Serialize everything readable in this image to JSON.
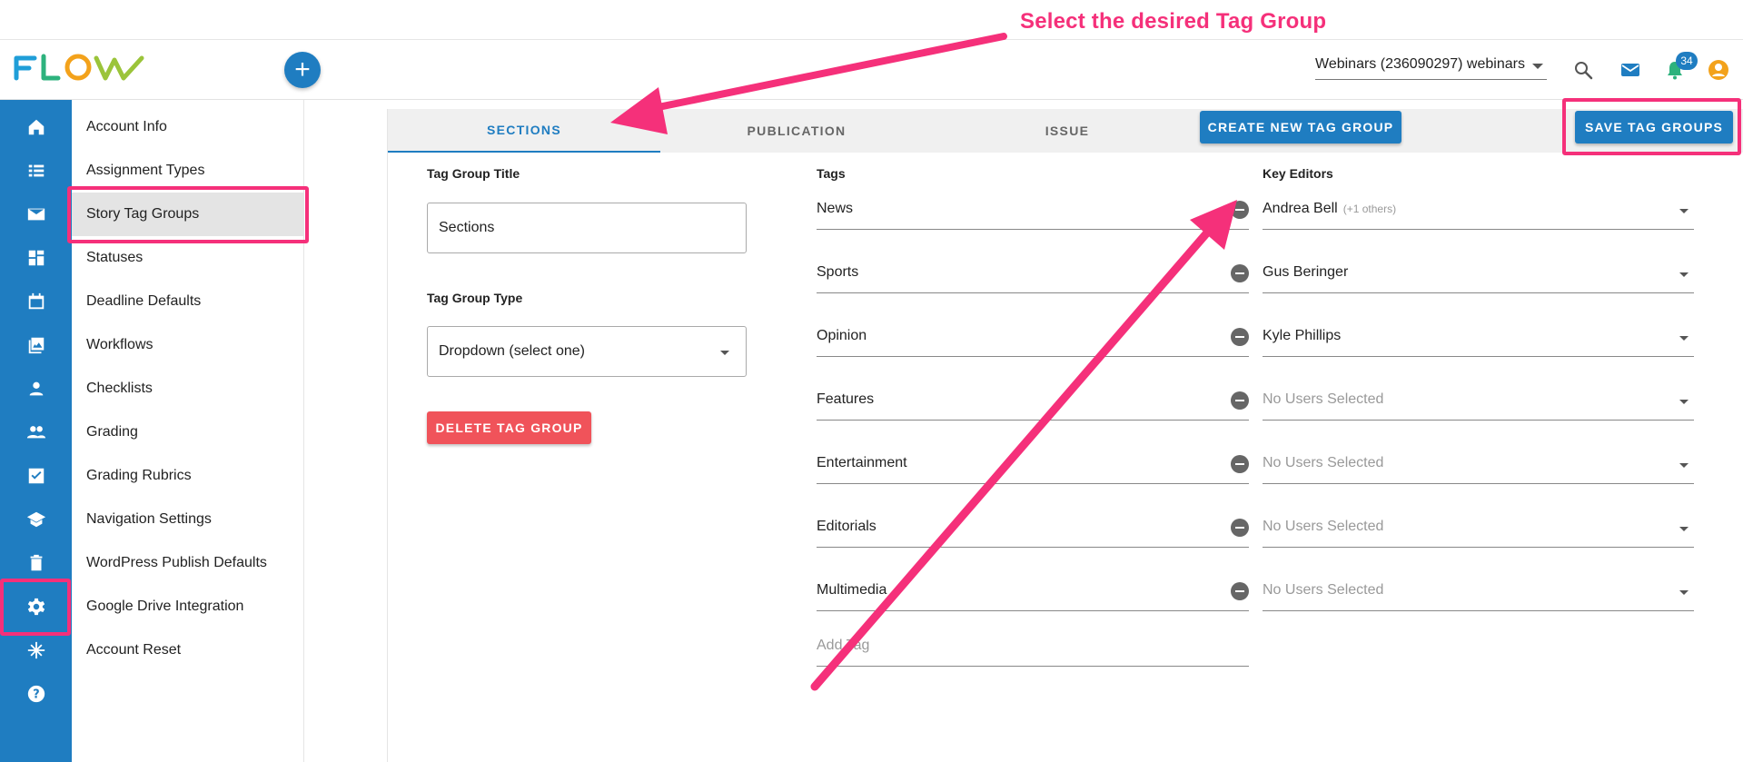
{
  "annotation": {
    "text": "Select the desired Tag Group"
  },
  "header": {
    "logo_text": "FLOW",
    "add_button": "+",
    "account_selector": "Webinars (236090297) webinars",
    "notification_count": "34",
    "icons": [
      "search-icon",
      "mail-icon",
      "bell-icon",
      "account-icon"
    ]
  },
  "rail": {
    "items": [
      "home-icon",
      "list-icon",
      "mail-icon",
      "dashboard-icon",
      "calendar-icon",
      "gallery-icon",
      "person-icon",
      "people-icon",
      "checkbox-icon",
      "school-icon",
      "trash-icon",
      "gear-icon",
      "snowflake-icon",
      "help-icon"
    ],
    "active": "gear-icon"
  },
  "menu": {
    "items": [
      {
        "label": "Account Info"
      },
      {
        "label": "Assignment Types"
      },
      {
        "label": "Story Tag Groups"
      },
      {
        "label": "Statuses"
      },
      {
        "label": "Deadline Defaults"
      },
      {
        "label": "Workflows"
      },
      {
        "label": "Checklists"
      },
      {
        "label": "Grading"
      },
      {
        "label": "Grading Rubrics"
      },
      {
        "label": "Navigation Settings"
      },
      {
        "label": "WordPress Publish Defaults"
      },
      {
        "label": "Google Drive Integration"
      },
      {
        "label": "Account Reset"
      }
    ],
    "active": "Story Tag Groups"
  },
  "tabs": [
    {
      "label": "SECTIONS",
      "active": true
    },
    {
      "label": "PUBLICATION",
      "active": false
    },
    {
      "label": "ISSUE",
      "active": false
    }
  ],
  "buttons": {
    "create": "CREATE NEW TAG GROUP",
    "save": "SAVE TAG GROUPS",
    "delete": "DELETE TAG GROUP"
  },
  "form": {
    "title_label": "Tag Group Title",
    "title_value": "Sections",
    "type_label": "Tag Group Type",
    "type_value": "Dropdown (select one)"
  },
  "tags": {
    "header": "Tags",
    "items": [
      "News",
      "Sports",
      "Opinion",
      "Features",
      "Entertainment",
      "Editorials",
      "Multimedia"
    ],
    "add_placeholder": "Add Tag"
  },
  "editors": {
    "header": "Key Editors",
    "items": [
      {
        "name": "Andrea Bell",
        "extra": "(+1 others)"
      },
      {
        "name": "Gus Beringer",
        "extra": ""
      },
      {
        "name": "Kyle Phillips",
        "extra": ""
      },
      {
        "name": "No Users Selected",
        "extra": ""
      },
      {
        "name": "No Users Selected",
        "extra": ""
      },
      {
        "name": "No Users Selected",
        "extra": ""
      },
      {
        "name": "No Users Selected",
        "extra": ""
      }
    ]
  },
  "colors": {
    "brand_blue": "#1f7dc1",
    "highlight_pink": "#f5307a",
    "delete_red": "#f0535a"
  }
}
